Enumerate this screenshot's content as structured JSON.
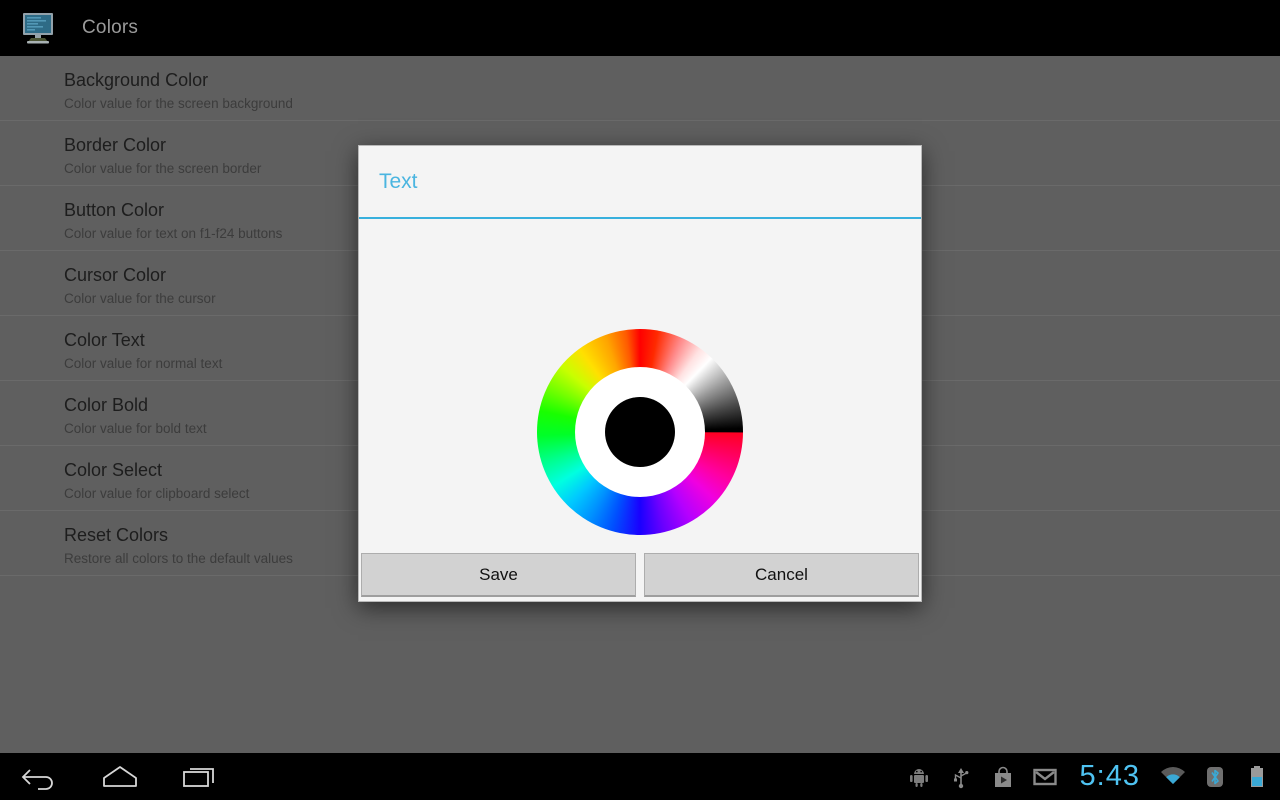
{
  "appbar": {
    "icon": "terminal-monitor-icon",
    "title": "Colors"
  },
  "preferences": [
    {
      "title": "Background Color",
      "summary": "Color value for the screen background"
    },
    {
      "title": "Border Color",
      "summary": "Color value for the screen border"
    },
    {
      "title": "Button Color",
      "summary": "Color value for text on f1-f24 buttons"
    },
    {
      "title": "Cursor Color",
      "summary": "Color value for the cursor"
    },
    {
      "title": "Color Text",
      "summary": "Color value for normal text"
    },
    {
      "title": "Color Bold",
      "summary": "Color value for bold text"
    },
    {
      "title": "Color Select",
      "summary": "Color value for clipboard select"
    },
    {
      "title": "Reset Colors",
      "summary": "Restore all colors to the default values"
    }
  ],
  "dialog": {
    "title": "Text",
    "accent_color": "#33b5e5",
    "selected_color": "#000000",
    "picker": "color-wheel",
    "buttons": {
      "save": "Save",
      "cancel": "Cancel"
    }
  },
  "navbar": {
    "back": "back-icon",
    "home": "home-icon",
    "recents": "recents-icon"
  },
  "statusbar": {
    "icons": [
      "android-debug-icon",
      "usb-icon",
      "play-store-icon",
      "gmail-icon"
    ],
    "clock": "5:43",
    "wifi": "wifi-icon",
    "bluetooth": "bluetooth-icon",
    "battery": "battery-icon",
    "clock_color": "#4fc3f2"
  }
}
